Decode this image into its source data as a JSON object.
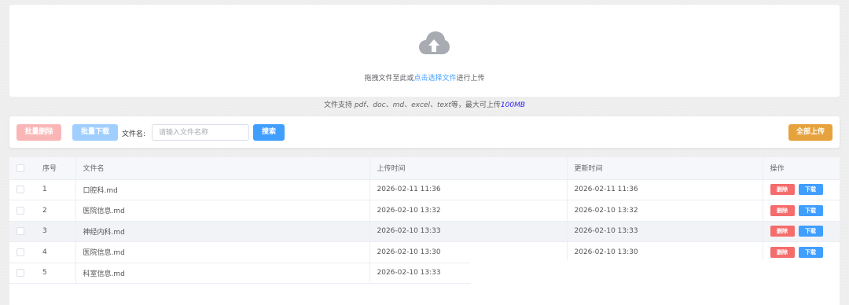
{
  "upload": {
    "hint_prefix": "拖拽文件至此或",
    "hint_link": "点击选择文件",
    "hint_suffix": "进行上传",
    "tip_prefix": "文件支持 ",
    "tip_types": "pdf、doc、md、excel、text",
    "tip_mid": "等，最大可上传",
    "tip_max": "100MB"
  },
  "toolbar": {
    "batch_delete_label": "批量删除",
    "batch_download_label": "批量下载",
    "filename_label": "文件名:",
    "search_placeholder": "请输入文件名称",
    "search_label": "搜索",
    "upload_all_label": "全部上传"
  },
  "table": {
    "headers": {
      "index": "序号",
      "name": "文件名",
      "upload_time": "上传时间",
      "update_time": "更新时间",
      "actions": "操作"
    },
    "delete_label": "删除",
    "download_label": "下载",
    "rows": [
      {
        "index": "1",
        "name": "口腔科.md",
        "upload_time": "2026-02-11 11:36",
        "update_time": "2026-02-11 11:36"
      },
      {
        "index": "2",
        "name": "医院信息.md",
        "upload_time": "2026-02-10 13:32",
        "update_time": "2026-02-10 13:32"
      },
      {
        "index": "3",
        "name": "神经内科.md",
        "upload_time": "2026-02-10 13:33",
        "update_time": "2026-02-10 13:33"
      },
      {
        "index": "4",
        "name": "医院信息.md",
        "upload_time": "2026-02-10 13:30",
        "update_time": "2026-02-10 13:30"
      },
      {
        "index": "5",
        "name": "科室信息.md",
        "upload_time": "2026-02-10 13:33",
        "update_time": ""
      }
    ]
  },
  "colors": {
    "primary": "#409eff",
    "danger": "#f56c6c",
    "warning": "#e6a23c",
    "danger_light": "#fab6b6",
    "primary_light": "#a0cfff"
  },
  "icons": {
    "upload": "cloud-upload-icon",
    "checkbox": "checkbox-icon"
  }
}
